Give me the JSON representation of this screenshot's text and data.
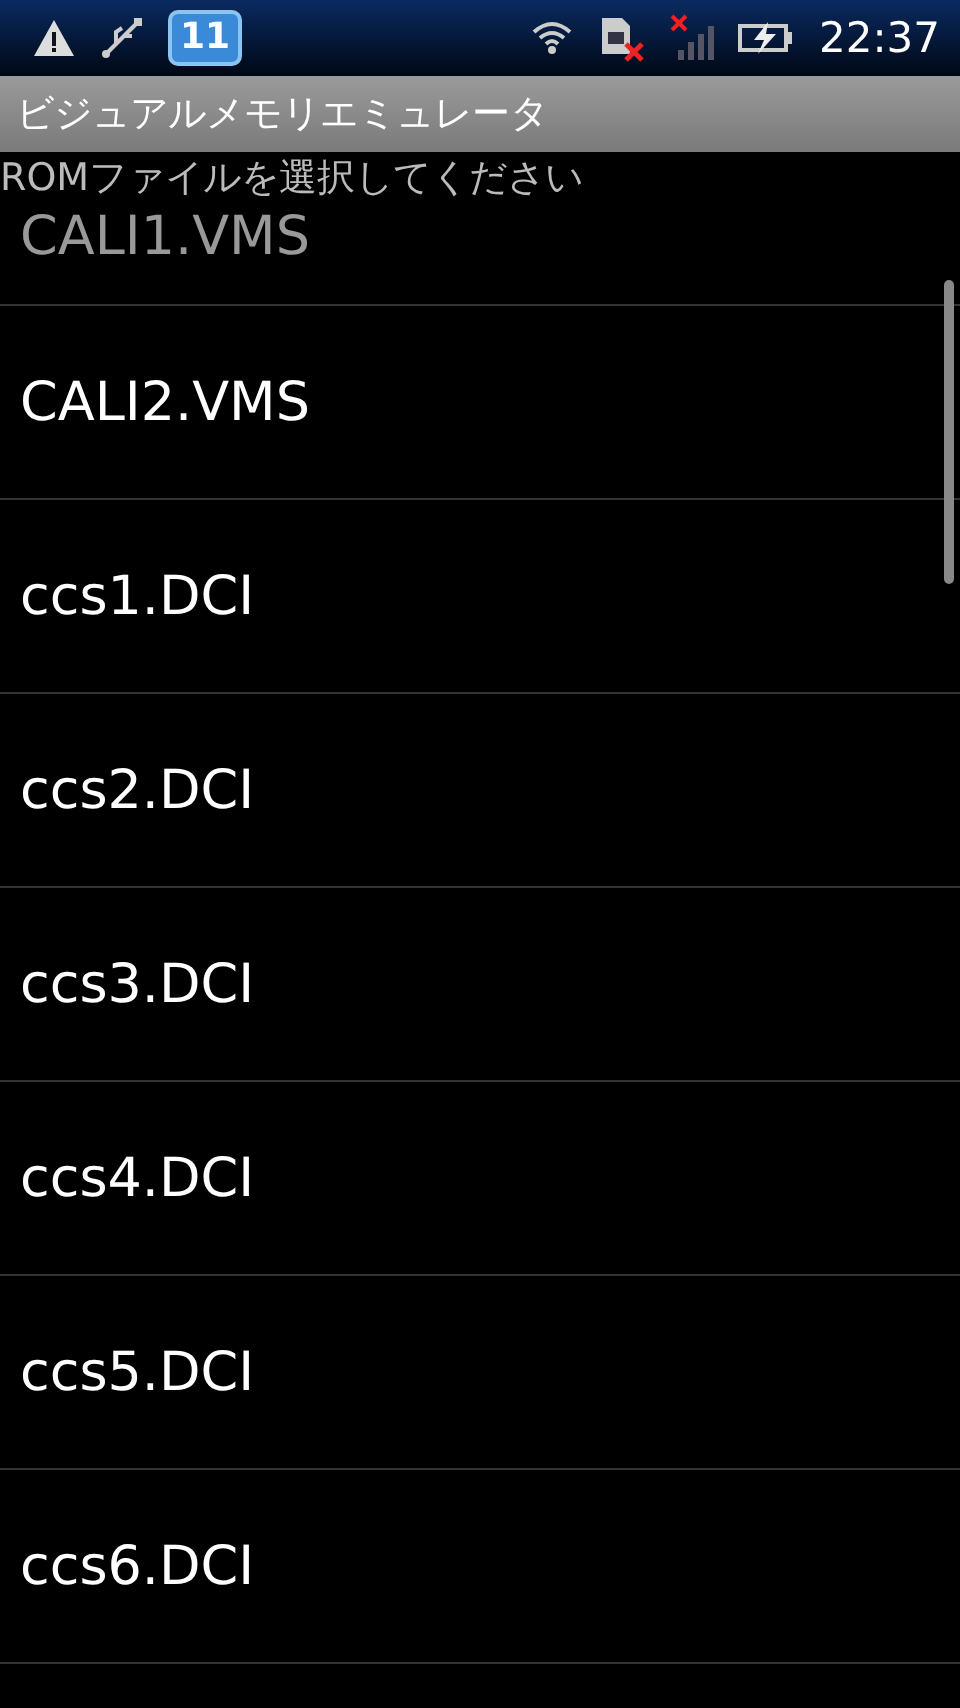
{
  "status_bar": {
    "notification_count": "11",
    "time": "22:37"
  },
  "title_bar": {
    "title": "ビジュアルメモリエミュレータ"
  },
  "prompt": "ROMファイルを選択してください",
  "files": [
    {
      "name": "CALI1.VMS",
      "partial": true
    },
    {
      "name": "CALI2.VMS",
      "partial": false
    },
    {
      "name": "ccs1.DCI",
      "partial": false
    },
    {
      "name": "ccs2.DCI",
      "partial": false
    },
    {
      "name": "ccs3.DCI",
      "partial": false
    },
    {
      "name": "ccs4.DCI",
      "partial": false
    },
    {
      "name": "ccs5.DCI",
      "partial": false
    },
    {
      "name": "ccs6.DCI",
      "partial": false
    }
  ]
}
